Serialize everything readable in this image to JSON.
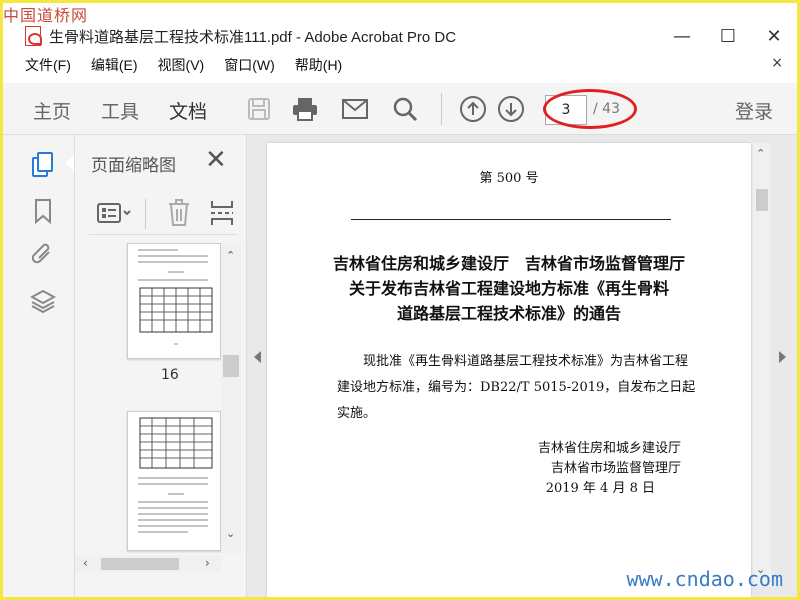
{
  "watermarks": {
    "top_left": "中国道桥网",
    "bottom_right": "www.cndao.com"
  },
  "window": {
    "title": "生骨料道路基层工程技术标准111.pdf - Adobe Acrobat Pro DC",
    "buttons": {
      "minimize": "—",
      "maximize": "☐",
      "close": "✕"
    }
  },
  "menu": {
    "items": [
      "文件(F)",
      "编辑(E)",
      "视图(V)",
      "窗口(W)",
      "帮助(H)"
    ],
    "close": "×"
  },
  "toolbar": {
    "tabs": [
      "主页",
      "工具",
      "文档"
    ],
    "active_tab": "文档",
    "icons": [
      "save-icon",
      "print-icon",
      "email-icon",
      "search-icon",
      "page-up-icon",
      "page-down-icon"
    ],
    "page_current": "3",
    "page_total": "/ 43",
    "login": "登录"
  },
  "rail": {
    "icons": [
      "pages-icon",
      "bookmark-icon",
      "attachment-icon",
      "layers-icon"
    ]
  },
  "thumbnails": {
    "header": "页面缩略图",
    "close": "✕",
    "tools": [
      "options-icon",
      "delete-icon",
      "extract-icon"
    ],
    "pages": [
      {
        "number": "16"
      },
      {
        "number": ""
      }
    ]
  },
  "document": {
    "page_number": "第 500 号",
    "title_lines": [
      "吉林省住房和城乡建设厅　吉林省市场监督管理厅",
      "关于发布吉林省工程建设地方标准《再生骨料",
      "道路基层工程技术标准》的通告"
    ],
    "body": "现批准《再生骨料道路基层工程技术标准》为吉林省工程建设地方标准，编号为：DB22/T 5015-2019，自发布之日起实施。",
    "signatures": [
      "吉林省住房和城乡建设厅",
      "吉林省市场监督管理厅",
      "2019 年 4 月 8 日"
    ]
  },
  "colors": {
    "annotation": "#e02020",
    "toolbar_bg": "#f4f4f4",
    "frame": "#f5e642"
  }
}
